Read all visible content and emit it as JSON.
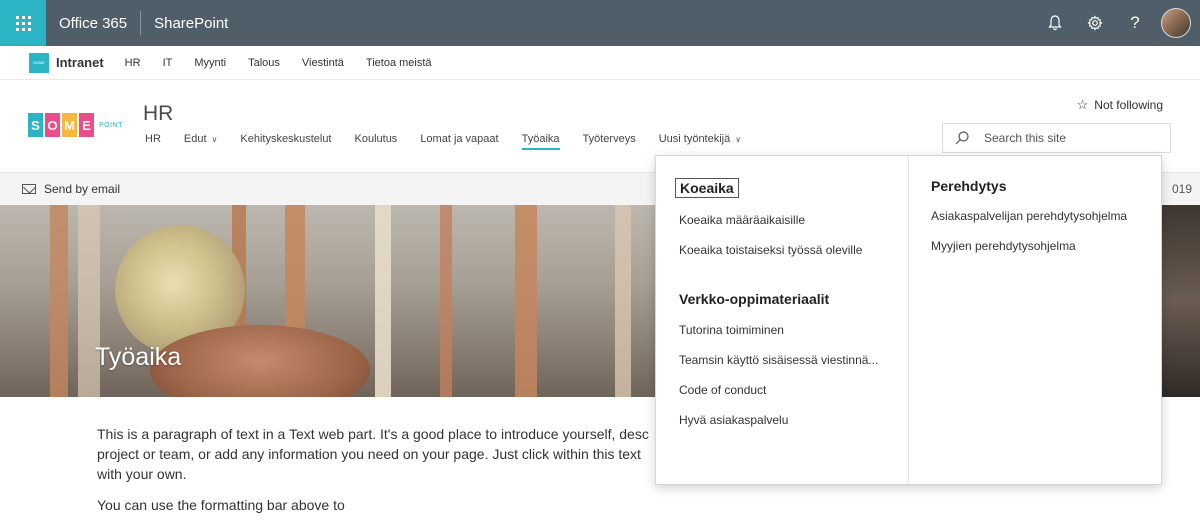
{
  "suitebar": {
    "app_launcher": "app-launcher",
    "title": "Office 365",
    "app": "SharePoint",
    "icons": [
      "bell-icon",
      "gear-icon",
      "help-icon"
    ],
    "help_glyph": "?"
  },
  "hubnav": {
    "logo_text": "SOME",
    "title": "Intranet",
    "links": [
      "HR",
      "IT",
      "Myynti",
      "Talous",
      "Viestintä",
      "Tietoa meistä"
    ]
  },
  "site": {
    "logo_letters": [
      "S",
      "O",
      "M",
      "E"
    ],
    "logo_point": "POINT",
    "title": "HR",
    "nav": [
      {
        "label": "HR"
      },
      {
        "label": "Edut",
        "has_menu": true
      },
      {
        "label": "Kehityskeskustelut"
      },
      {
        "label": "Koulutus"
      },
      {
        "label": "Lomat ja vapaat"
      },
      {
        "label": "Työaika",
        "active": true
      },
      {
        "label": "Työterveys"
      },
      {
        "label": "Uusi työntekijä",
        "has_menu": true
      }
    ],
    "follow_label": "Not following",
    "search_placeholder": "Search this site"
  },
  "cmdbar": {
    "send_label": "Send by email",
    "date_fragment": "019"
  },
  "banner": {
    "title": "Työaika"
  },
  "content": {
    "paragraph1": "This is a paragraph of text in a Text web part. It's a good place to introduce yourself, desc project or team, or add any information you need on your page. Just click within this text with your own.",
    "paragraph2": "You can use the formatting bar above to"
  },
  "megamenu": {
    "left": {
      "group1": {
        "heading": "Koeaika",
        "links": [
          "Koeaika määräaikaisille",
          "Koeaika toistaiseksi työssä oleville"
        ]
      },
      "group2": {
        "heading": "Verkko-oppimateriaalit",
        "links": [
          "Tutorina toimiminen",
          "Teamsin käyttö sisäisessä viestinnä...",
          "Code of conduct",
          "Hyvä asiakaspalvelu"
        ]
      }
    },
    "right": {
      "heading": "Perehdytys",
      "links": [
        "Asiakaspalvelijan perehdytysohjelma",
        "Myyjien perehdytysohjelma"
      ]
    }
  },
  "colors": {
    "suitebar": "#505e69",
    "accent": "#2bb5c4",
    "logo_s": "#2bb5c4",
    "logo_o": "#e94e8a",
    "logo_m": "#f6b73c",
    "logo_e": "#e94e8a"
  }
}
